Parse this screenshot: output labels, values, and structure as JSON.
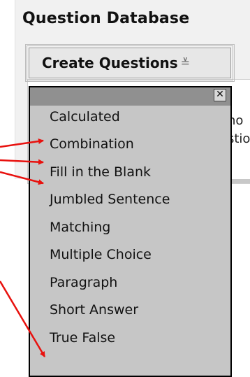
{
  "page": {
    "title": "Question Database"
  },
  "toolbar": {
    "create_label": "Create Questions",
    "create_icon": "chevron-down-icon"
  },
  "background": {
    "line1": "no",
    "line2": "stio"
  },
  "dropdown": {
    "close_glyph": "✕",
    "items": [
      "Calculated",
      "Combination",
      "Fill in the Blank",
      "Jumbled Sentence",
      "Matching",
      "Multiple Choice",
      "Paragraph",
      "Short Answer",
      "True False"
    ]
  },
  "annotation": {
    "arrow_color": "#e8110e",
    "highlighted_items": [
      "Combination",
      "Fill in the Blank",
      "Jumbled Sentence",
      "True False"
    ]
  }
}
